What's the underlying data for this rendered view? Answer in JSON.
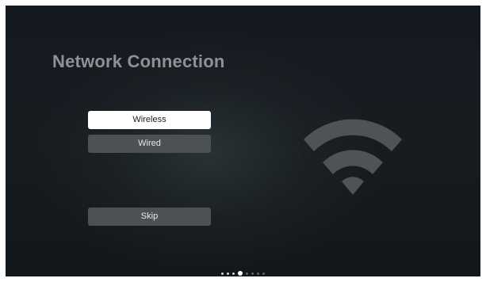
{
  "screen": {
    "title": "Network Connection"
  },
  "menu": {
    "options": [
      {
        "label": "Wireless",
        "selected": true
      },
      {
        "label": "Wired",
        "selected": false
      }
    ],
    "skip_label": "Skip"
  },
  "illustration": {
    "icon": "wifi-icon"
  },
  "pagination": {
    "total_steps": 8,
    "current_step": 4
  },
  "colors": {
    "background": "#161c20",
    "title_text": "#8c9296",
    "button": "#4b5154",
    "button_selected": "#ffffff",
    "wifi_icon": "#4d5357"
  }
}
